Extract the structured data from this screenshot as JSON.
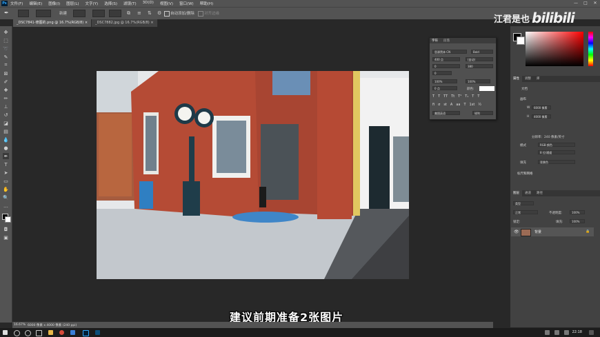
{
  "menubar": {
    "logo": "Ps",
    "items": [
      "文件(F)",
      "编辑(E)",
      "图像(I)",
      "图层(L)",
      "文字(Y)",
      "选择(S)",
      "滤镜(T)",
      "3D(D)",
      "视图(V)",
      "窗口(W)",
      "帮助(H)"
    ],
    "window_controls": [
      "—",
      "□",
      "✕"
    ]
  },
  "options": {
    "mode_label": "新建",
    "auto_add_delete": "自动添加/删除",
    "align_edges": "对齐边缘"
  },
  "tabs": [
    {
      "label": "_DSC7841-修图的.png @ 16.7%(RGB/8)",
      "close": "×"
    },
    {
      "label": "_DSC7882.jpg @ 16.7%(RGB/8)",
      "close": "×"
    }
  ],
  "status": {
    "zoom": "16.67%",
    "doc_info": "6000 像素 x 4000 像素 (240 ppi)"
  },
  "subtitle": "建议前期准备2张图片",
  "watermark": {
    "text": "江君是也",
    "logo": "bilibili"
  },
  "char_panel": {
    "tabs": [
      "字符",
      "段落"
    ],
    "font": "思源黑体 CN",
    "style": "Bold",
    "size": "400 点",
    "leading": "(自动)",
    "kerning": "0",
    "tracking": "0",
    "vscale": "100%",
    "hscale": "100%",
    "baseline": "0 点",
    "color_label": "颜色:",
    "language": "美国英语",
    "aa": "锐利",
    "tracking_value": "380"
  },
  "right_dock": {
    "properties_tabs": [
      "属性",
      "调整",
      "库"
    ],
    "doc_label": "文档",
    "canvas_label": "画布",
    "w_label": "W",
    "w_value": "6000 像素",
    "h_label": "H",
    "h_value": "4000 像素",
    "resolution": "分辨率：240 像素/英寸",
    "mode_label": "模式",
    "mode_value": "RGB 颜色",
    "depth_value": "8 位/通道",
    "fill_label": "填充",
    "fill_value": "背景色",
    "rulers_label": "标尺和网格",
    "layers_tabs": [
      "图层",
      "通道",
      "路径"
    ],
    "layer_kind": "类型",
    "opacity_label": "不透明度:",
    "opacity_value": "100%",
    "lock_label": "锁定:",
    "fill_opacity_label": "填充:",
    "fill_opacity_value": "100%",
    "blend_mode": "正常",
    "layer_name": "背景"
  },
  "taskbar": {
    "time": "22:18"
  },
  "colors": {
    "ui_dark": "#282828",
    "panel": "#535353",
    "accent": "#31a8ff",
    "subtitle": "#ffffff"
  }
}
